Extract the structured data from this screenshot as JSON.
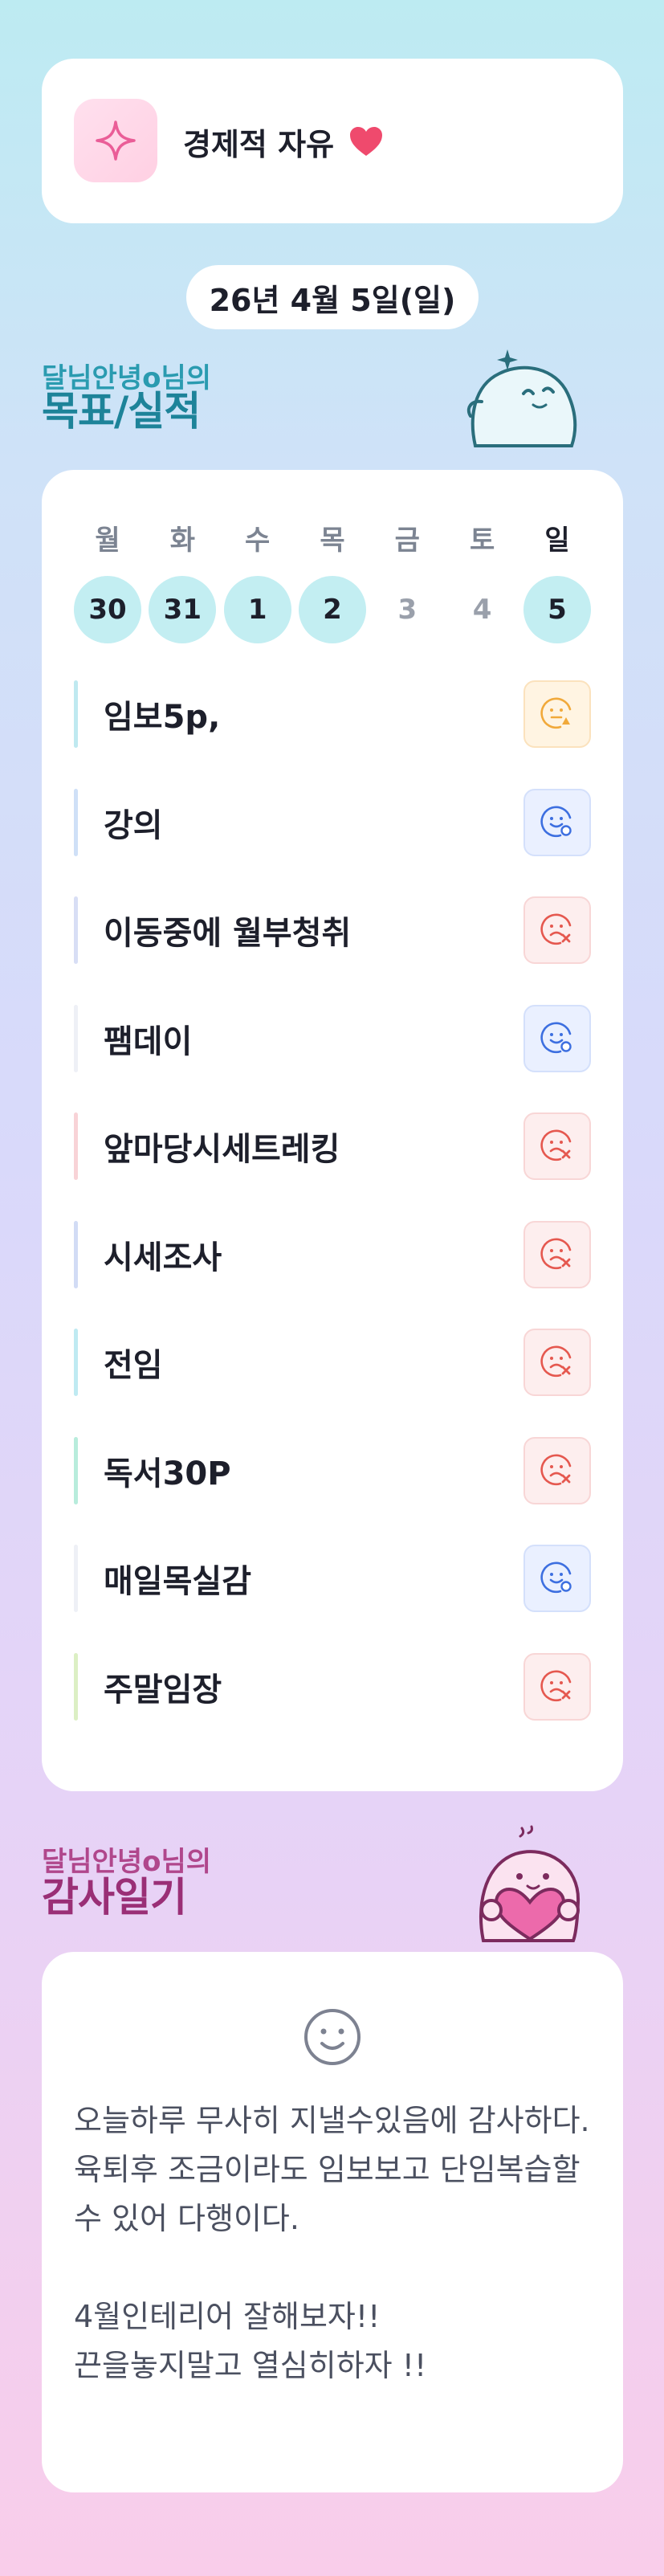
{
  "goal_header": {
    "title": "경제적 자유",
    "heart_icon": "heart-icon",
    "sparkle_icon": "sparkle-icon"
  },
  "date_label": "26년 4월 5일(일)",
  "goals_section": {
    "subtitle": "달님안녕o님의",
    "title": "목표/실적"
  },
  "calendar": {
    "weekdays": [
      "월",
      "화",
      "수",
      "목",
      "금",
      "토",
      "일"
    ],
    "days": [
      "30",
      "31",
      "1",
      "2",
      "3",
      "4",
      "5"
    ]
  },
  "goals": [
    {
      "label": "임보5p,",
      "status": "warning",
      "bar_color": "#bfe9f0"
    },
    {
      "label": "강의",
      "status": "done",
      "bar_color": "#cfe0f7"
    },
    {
      "label": "이동중에 월부청취",
      "status": "failed",
      "bar_color": "#d8def5"
    },
    {
      "label": "팸데이",
      "status": "done",
      "bar_color": "#eef0f6"
    },
    {
      "label": "앞마당시세트레킹",
      "status": "failed",
      "bar_color": "#f8d3d7"
    },
    {
      "label": "시세조사",
      "status": "failed",
      "bar_color": "#d2dcf5"
    },
    {
      "label": "전임",
      "status": "failed",
      "bar_color": "#bfeaf2"
    },
    {
      "label": "독서30P",
      "status": "failed",
      "bar_color": "#b8ecdc"
    },
    {
      "label": "매일목실감",
      "status": "done",
      "bar_color": "#eef0f6"
    },
    {
      "label": "주말임장",
      "status": "failed",
      "bar_color": "#dcefc4"
    }
  ],
  "thanks_section": {
    "subtitle": "달님안녕o님의",
    "title": "감사일기"
  },
  "thanks_text": "오늘하루 무사히 지낼수있음에 감사하다.\n육퇴후 조금이라도 임보보고 단임복습할수 있어 다행이다.\n\n4월인테리어 잘해보자!!\n끈을놓지말고 열심히하자 !!",
  "colors": {
    "teal": "#1d8399",
    "magenta": "#9a2f76",
    "fail": "#e5584f",
    "ok": "#3d6fe0",
    "warn": "#f1a93a"
  }
}
